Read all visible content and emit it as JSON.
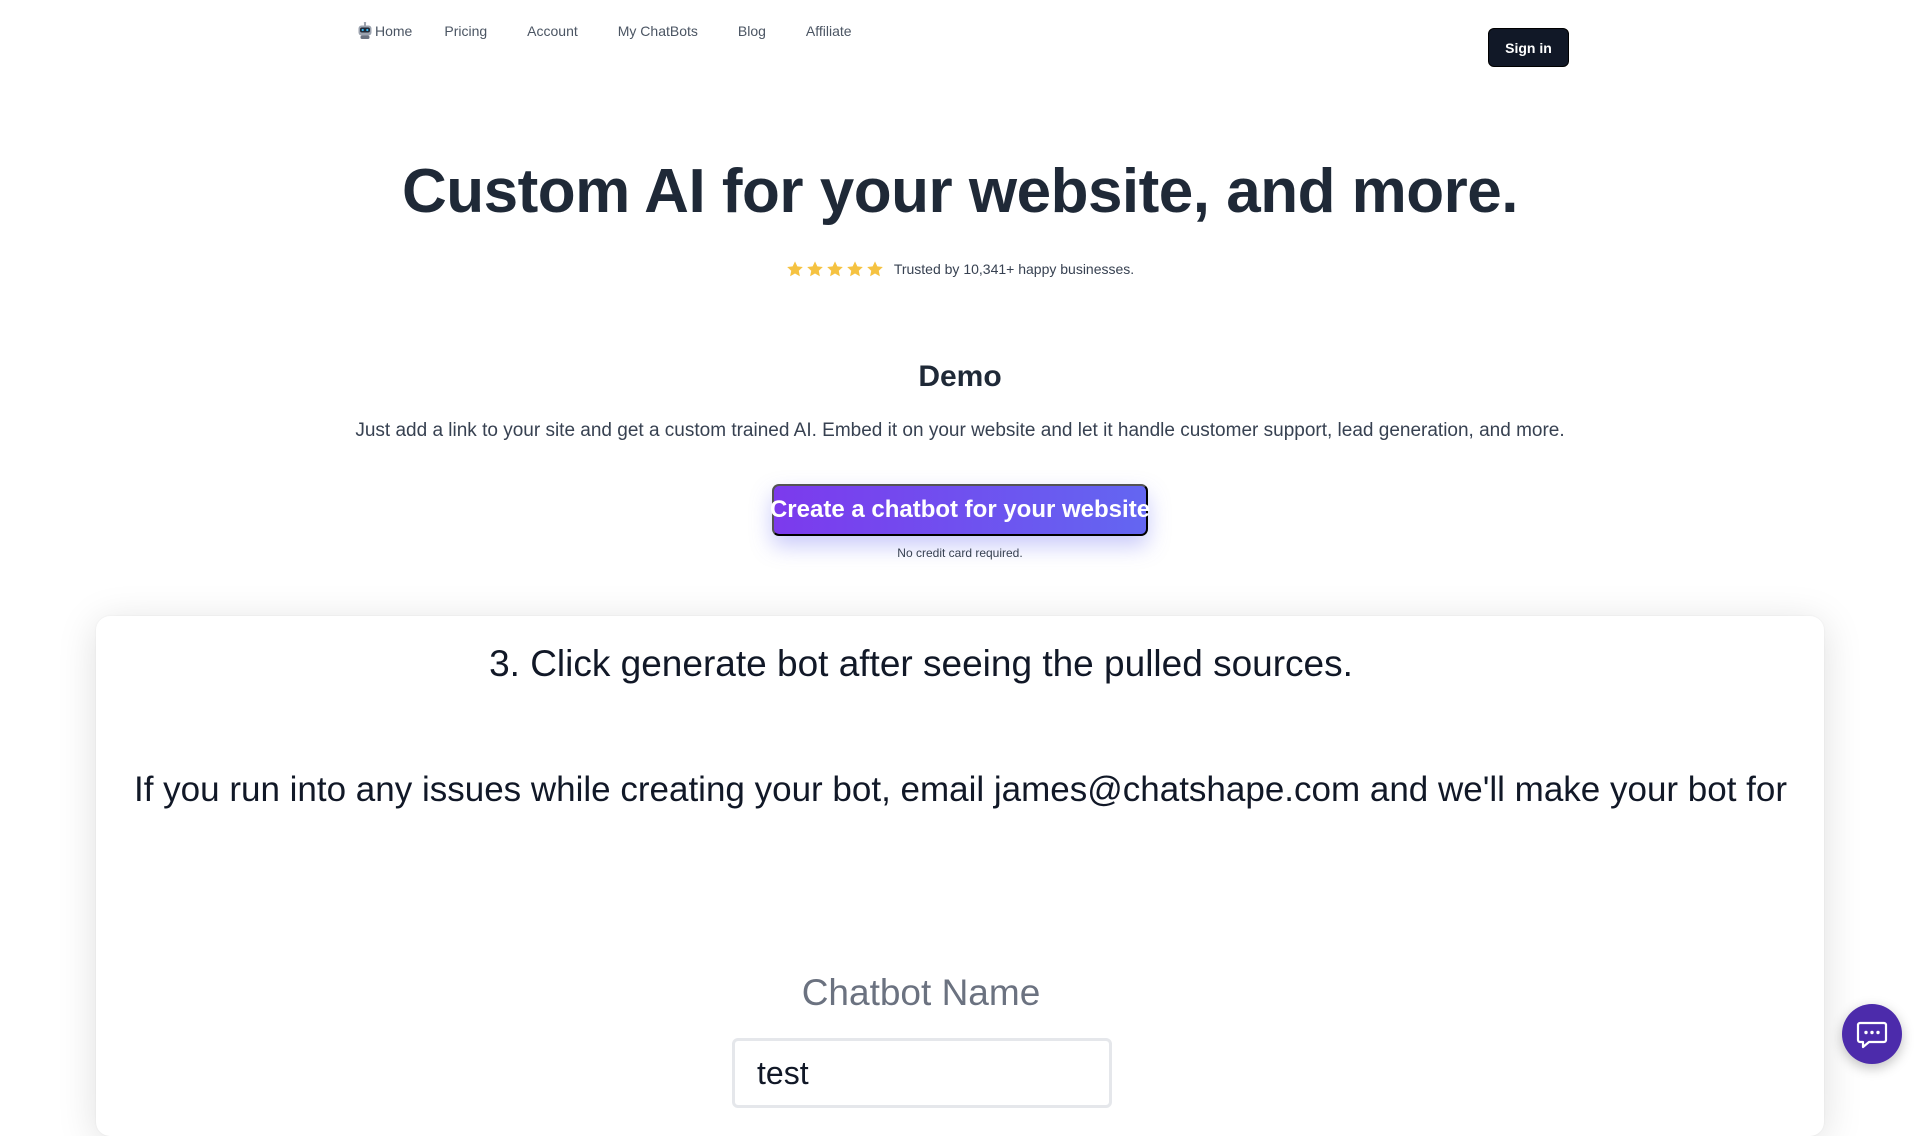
{
  "nav": {
    "items": [
      {
        "label": "Home",
        "icon": "robot-logo-icon"
      },
      {
        "label": "Pricing"
      },
      {
        "label": "Account"
      },
      {
        "label": "My ChatBots"
      },
      {
        "label": "Blog"
      },
      {
        "label": "Affiliate"
      }
    ],
    "signin_label": "Sign in"
  },
  "hero": {
    "title": "Custom AI for your website, and more.",
    "rating_stars": 5,
    "star_color": "#f5c241",
    "trust_text": "Trusted by 10,341+ happy businesses."
  },
  "demo": {
    "title": "Demo",
    "description": "Just add a link to your site and get a custom trained AI. Embed it on your website and let it handle customer support, lead generation, and more.",
    "cta_label": "Create a chatbot for your website",
    "cta_note": "No credit card required.",
    "cta_gradient": [
      "#7c3aed",
      "#6366f1"
    ]
  },
  "demo_frame": {
    "step_text": "3. Click generate bot after seeing the pulled sources.",
    "issues_text": "If you run into any issues while creating your bot, email james@chatshape.com and we'll make your bot for you!",
    "chatbot_name_label": "Chatbot Name",
    "chatbot_name_value": "test"
  },
  "chat_widget": {
    "icon": "chat-bubble-icon",
    "color": "#4c2bab"
  }
}
